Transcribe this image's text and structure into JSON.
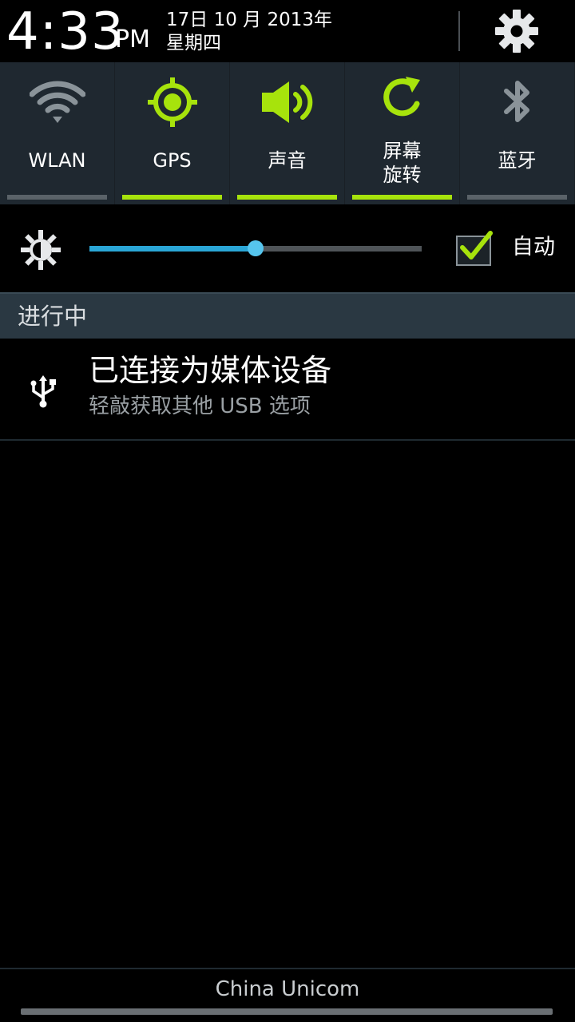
{
  "header": {
    "time": "4:33",
    "ampm": "PM",
    "date": "17日 10 月 2013年",
    "weekday": "星期四",
    "settings_icon": "gear-icon"
  },
  "toggles": [
    {
      "label": "WLAN",
      "icon": "wifi-icon",
      "active": false
    },
    {
      "label": "GPS",
      "icon": "gps-icon",
      "active": true
    },
    {
      "label": "声音",
      "icon": "sound-icon",
      "active": true
    },
    {
      "label_line1": "屏幕",
      "label_line2": "旋转",
      "icon": "rotate-icon",
      "active": true
    },
    {
      "label": "蓝牙",
      "icon": "bluetooth-icon",
      "active": false
    }
  ],
  "brightness": {
    "icon": "brightness-icon",
    "level_fraction": 0.5,
    "auto_label": "自动",
    "auto_checked": true
  },
  "section": {
    "ongoing_label": "进行中"
  },
  "notification": {
    "icon": "usb-icon",
    "title": "已连接为媒体设备",
    "subtitle": "轻敲获取其他 USB 选项"
  },
  "footer": {
    "carrier": "China Unicom"
  },
  "colors": {
    "accent_on": "#a7e30c",
    "accent_off": "#5a6268",
    "slider": "#2aa6d6",
    "panel": "#1f2830",
    "section_bg": "#2a3842"
  }
}
